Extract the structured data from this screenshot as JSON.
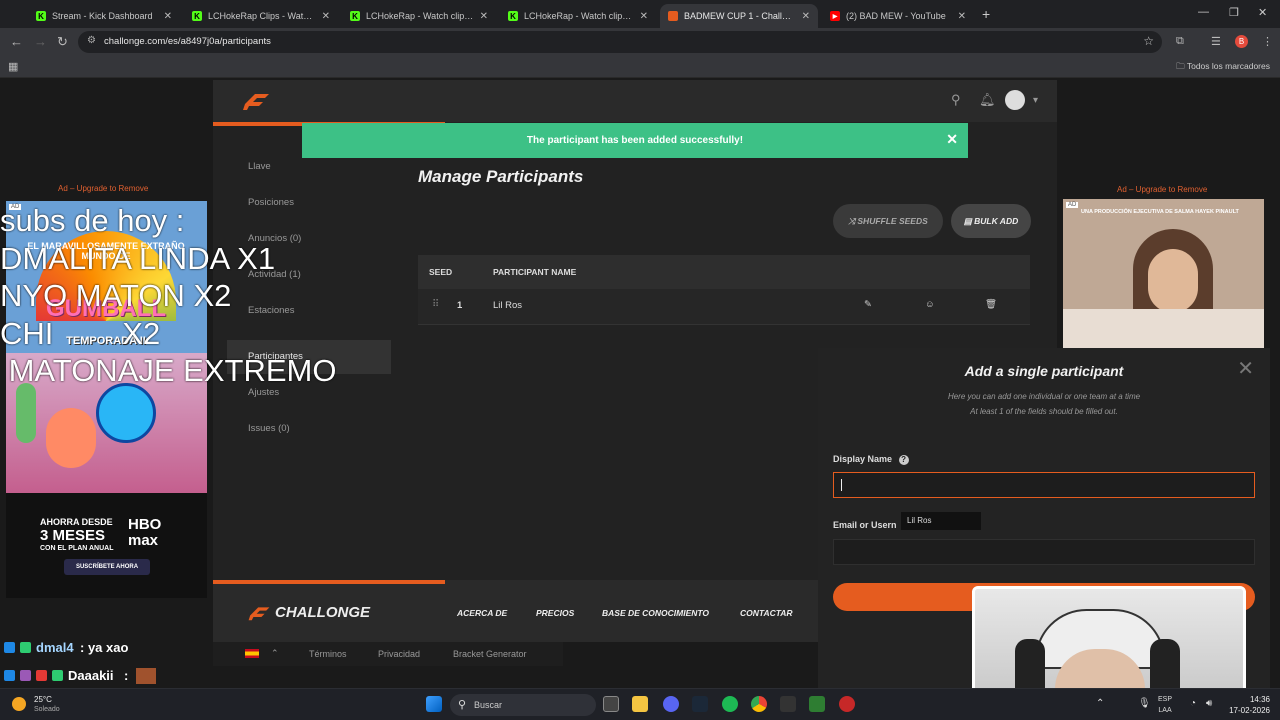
{
  "browser": {
    "tabs": [
      {
        "label": "Stream - Kick Dashboard",
        "fav_color": "#53fc18",
        "fav_glyph": "K"
      },
      {
        "label": "LCHokeRap Clips - Watch Live o",
        "fav_color": "#53fc18",
        "fav_glyph": "K"
      },
      {
        "label": "LCHokeRap - Watch clips on Ki",
        "fav_color": "#53fc18",
        "fav_glyph": "K"
      },
      {
        "label": "LCHokeRap - Watch clips on Ki",
        "fav_color": "#53fc18",
        "fav_glyph": "K"
      },
      {
        "label": "BADMEW CUP 1 - Challonge",
        "fav_color": "#e55c1f",
        "fav_glyph": ""
      },
      {
        "label": "(2) BAD MEW - YouTube",
        "fav_color": "#ff0000",
        "fav_glyph": "▶"
      }
    ],
    "active_tab": 4,
    "url": "challonge.com/es/a8497j0a/participants",
    "bookmarks_label": "Todos los marcadores",
    "profile_initial": "B"
  },
  "site": {
    "sidebar": [
      {
        "label": "Llave",
        "active": false
      },
      {
        "label": "Posiciones",
        "active": false
      },
      {
        "label": "Anuncios (0)",
        "active": false
      },
      {
        "label": "Actividad (1)",
        "active": false
      },
      {
        "label": "Estaciones",
        "active": false
      },
      {
        "label": "Participantes",
        "active": true
      },
      {
        "label": "Ajustes",
        "active": false
      },
      {
        "label": "Issues (0)",
        "active": false
      }
    ],
    "success_message": "The participant has been added successfully!",
    "title": "Manage Participants",
    "shuffle_label": "SHUFFLE SEEDS",
    "bulk_label": "BULK ADD",
    "table": {
      "headers": {
        "seed": "SEED",
        "name": "PARTICIPANT NAME"
      },
      "rows": [
        {
          "seed": "1",
          "name": "Lil Ros"
        }
      ]
    },
    "footer": {
      "brand": "CHALLONGE",
      "links": [
        "ACERCA DE",
        "PRECIOS",
        "BASE DE CONOCIMIENTO",
        "CONTACTAR"
      ],
      "sublinks": [
        "Términos",
        "Privacidad",
        "Bracket Generator"
      ]
    },
    "ads": {
      "upgrade_left": "Ad – Upgrade to Remove",
      "upgrade_right": "Ad – Upgrade to Remove",
      "left_top_text": "EL MARAVILLOSAMENTE EXTRAÑO MUNDO DE",
      "left_brand": "GUMBALL",
      "left_season": "TEMPORADA II",
      "hbo_line1": "AHORRA DESDE",
      "hbo_line2": "3 MESES",
      "hbo_line3": "CON EL PLAN ANUAL",
      "hbo_logo": "HBO max",
      "hbo_cta": "SUSCRÍBETE AHORA",
      "right_text": "UNA PRODUCCIÓN EJECUTIVA DE SALMA HAYEK PINAULT",
      "ad_badge": "AD"
    },
    "modal": {
      "title": "Add a single participant",
      "sub1": "Here you can add one individual or one team at a time",
      "sub2": "At least 1 of the fields should be filled out.",
      "display_name_label": "Display Name",
      "email_label": "Email or Usern",
      "autocomplete": "Lil Ros",
      "close_glyph": "✕"
    }
  },
  "overlay": {
    "subs_lines": [
      "subs de hoy :",
      "DMALITA LINDA X1",
      "NYO MATON X2",
      "CHI        X2",
      " MATONAJE EXTREMO"
    ],
    "chat": [
      {
        "user": "dmal4",
        "msg": ": ya xao"
      },
      {
        "user": "Daaakii",
        "msg": ":"
      }
    ]
  },
  "taskbar": {
    "temp": "25°C",
    "weather": "Soleado",
    "search_label": "Buscar",
    "lang1": "ESP",
    "lang2": "LAA",
    "time": "14:36",
    "date": "17-02-2026"
  }
}
